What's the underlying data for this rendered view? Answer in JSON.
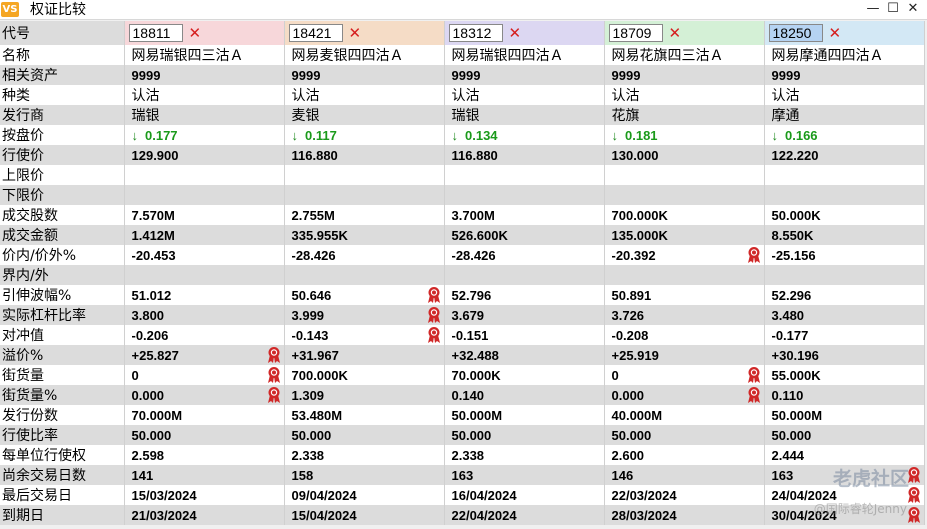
{
  "window": {
    "title": "权证比较",
    "app_icon_text": "VS",
    "min_glyph": "—",
    "max_glyph": "☐",
    "close_glyph": "✕"
  },
  "colors": {
    "col_tints": [
      "#f7d7da",
      "#f5dcc6",
      "#dcd7f2",
      "#d4f0d6",
      "#d3e8f5"
    ],
    "down_arrow": "#1f8a1f",
    "remove_x": "#d62020",
    "ribbon": "#d02828"
  },
  "labels": {
    "code": "代号",
    "name": "名称",
    "underlying": "相关资产",
    "type": "种类",
    "issuer": "发行商",
    "price": "按盘价",
    "strike": "行使价",
    "upper_limit": "上限价",
    "lower_limit": "下限价",
    "volume": "成交股数",
    "turnover": "成交金额",
    "moneyness": "价内/价外%",
    "in_out": "界内/外",
    "iv": "引伸波幅%",
    "eff_gearing": "实际杠杆比率",
    "delta": "对冲值",
    "premium": "溢价%",
    "outstanding": "街货量",
    "outstanding_pct": "街货量%",
    "issue_size": "发行份数",
    "exercise_ratio": "行使比率",
    "per_unit": "每单位行使权",
    "days_left": "尚余交易日数",
    "last_trade": "最后交易日",
    "expiry": "到期日"
  },
  "warrants": [
    {
      "code": "18811",
      "name": "网易瑞银四三沽Ａ",
      "underlying": "9999",
      "type": "认沽",
      "issuer": "瑞银",
      "price": "0.177",
      "strike": "129.900",
      "upper_limit": "",
      "lower_limit": "",
      "volume": "7.570M",
      "turnover": "1.412M",
      "moneyness": "-20.453",
      "in_out": "",
      "iv": "51.012",
      "eff_gearing": "3.800",
      "delta": "-0.206",
      "premium": "+25.827",
      "outstanding": "0",
      "outstanding_pct": "0.000",
      "issue_size": "70.000M",
      "exercise_ratio": "50.000",
      "per_unit": "2.598",
      "days_left": "141",
      "last_trade": "15/03/2024",
      "expiry": "21/03/2024",
      "ribbons": [
        "premium",
        "outstanding",
        "outstanding_pct"
      ]
    },
    {
      "code": "18421",
      "name": "网易麦银四四沽Ａ",
      "underlying": "9999",
      "type": "认沽",
      "issuer": "麦银",
      "price": "0.117",
      "strike": "116.880",
      "upper_limit": "",
      "lower_limit": "",
      "volume": "2.755M",
      "turnover": "335.955K",
      "moneyness": "-28.426",
      "in_out": "",
      "iv": "50.646",
      "eff_gearing": "3.999",
      "delta": "-0.143",
      "premium": "+31.967",
      "outstanding": "700.000K",
      "outstanding_pct": "1.309",
      "issue_size": "53.480M",
      "exercise_ratio": "50.000",
      "per_unit": "2.338",
      "days_left": "158",
      "last_trade": "09/04/2024",
      "expiry": "15/04/2024",
      "ribbons": [
        "iv",
        "eff_gearing",
        "delta"
      ]
    },
    {
      "code": "18312",
      "name": "网易瑞银四四沽Ａ",
      "underlying": "9999",
      "type": "认沽",
      "issuer": "瑞银",
      "price": "0.134",
      "strike": "116.880",
      "upper_limit": "",
      "lower_limit": "",
      "volume": "3.700M",
      "turnover": "526.600K",
      "moneyness": "-28.426",
      "in_out": "",
      "iv": "52.796",
      "eff_gearing": "3.679",
      "delta": "-0.151",
      "premium": "+32.488",
      "outstanding": "70.000K",
      "outstanding_pct": "0.140",
      "issue_size": "50.000M",
      "exercise_ratio": "50.000",
      "per_unit": "2.338",
      "days_left": "163",
      "last_trade": "16/04/2024",
      "expiry": "22/04/2024",
      "ribbons": []
    },
    {
      "code": "18709",
      "name": "网易花旗四三沽Ａ",
      "underlying": "9999",
      "type": "认沽",
      "issuer": "花旗",
      "price": "0.181",
      "strike": "130.000",
      "upper_limit": "",
      "lower_limit": "",
      "volume": "700.000K",
      "turnover": "135.000K",
      "moneyness": "-20.392",
      "in_out": "",
      "iv": "50.891",
      "eff_gearing": "3.726",
      "delta": "-0.208",
      "premium": "+25.919",
      "outstanding": "0",
      "outstanding_pct": "0.000",
      "issue_size": "40.000M",
      "exercise_ratio": "50.000",
      "per_unit": "2.600",
      "days_left": "146",
      "last_trade": "22/03/2024",
      "expiry": "28/03/2024",
      "ribbons": [
        "moneyness",
        "outstanding",
        "outstanding_pct"
      ]
    },
    {
      "code": "18250",
      "name": "网易摩通四四沽Ａ",
      "underlying": "9999",
      "type": "认沽",
      "issuer": "摩通",
      "price": "0.166",
      "strike": "122.220",
      "upper_limit": "",
      "lower_limit": "",
      "volume": "50.000K",
      "turnover": "8.550K",
      "moneyness": "-25.156",
      "in_out": "",
      "iv": "52.296",
      "eff_gearing": "3.480",
      "delta": "-0.177",
      "premium": "+30.196",
      "outstanding": "55.000K",
      "outstanding_pct": "0.110",
      "issue_size": "50.000M",
      "exercise_ratio": "50.000",
      "per_unit": "2.444",
      "days_left": "163",
      "last_trade": "24/04/2024",
      "expiry": "30/04/2024",
      "ribbons": [
        "days_left",
        "last_trade",
        "expiry"
      ]
    }
  ],
  "watermark": {
    "brand": "老虎社区",
    "user": "@国际睿轮Jenny"
  }
}
